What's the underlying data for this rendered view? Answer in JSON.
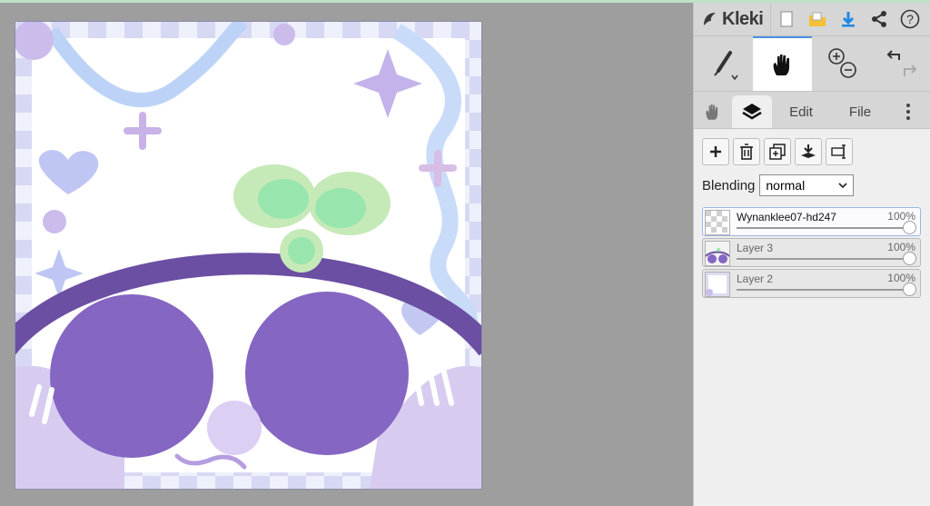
{
  "app": {
    "name": "Kleki"
  },
  "toolbar": {
    "icons": [
      "new-image-icon",
      "open-folder-icon",
      "save-download-icon",
      "share-icon",
      "help-icon"
    ],
    "accent_color": "#1e88e5"
  },
  "tools": {
    "items": [
      "brush-icon",
      "hand-icon",
      "zoom-icon",
      "undo-redo-icon"
    ],
    "active": "hand"
  },
  "tabs": {
    "hand_icon": "hand-icon",
    "layers_icon": "layers-icon",
    "edit_label": "Edit",
    "file_label": "File",
    "active": "layers"
  },
  "layers_panel": {
    "buttons": [
      "add-layer-icon",
      "delete-layer-icon",
      "duplicate-layer-icon",
      "merge-layer-icon",
      "rename-layer-icon"
    ],
    "blending_label": "Blending",
    "blending_value": "normal",
    "layers": [
      {
        "name": "Wynanklee07-hd247",
        "opacity": "100%",
        "selected": true
      },
      {
        "name": "Layer 3",
        "opacity": "100%",
        "selected": false
      },
      {
        "name": "Layer 2",
        "opacity": "100%",
        "selected": false
      }
    ]
  },
  "canvas": {
    "description_colors": {
      "purple": "#8566c2",
      "band": "#6b4fa3",
      "leaf_green": "#98e6ad",
      "lavender": "#c9b8ec",
      "ribbon": "#bcd3f7"
    }
  }
}
